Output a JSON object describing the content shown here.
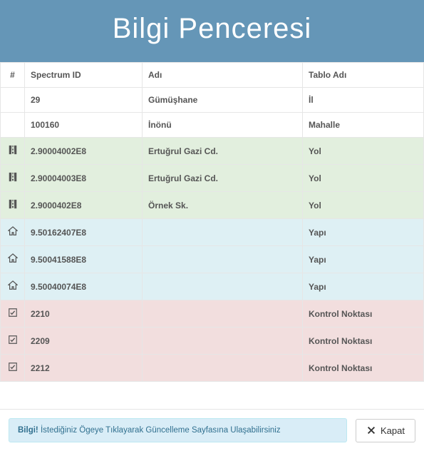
{
  "header": {
    "title": "Bilgi Penceresi"
  },
  "table": {
    "columns": [
      "#",
      "Spectrum ID",
      "Adı",
      "Tablo Adı"
    ],
    "rows": [
      {
        "icon": "",
        "row_class": "plain",
        "spectrum_id": "29",
        "name": "Gümüşhane",
        "table_name": "İl"
      },
      {
        "icon": "",
        "row_class": "plain",
        "spectrum_id": "100160",
        "name": "İnönü",
        "table_name": "Mahalle"
      },
      {
        "icon": "road",
        "row_class": "green",
        "spectrum_id": "2.90004002E8",
        "name": "Ertuğrul Gazi Cd.",
        "table_name": "Yol"
      },
      {
        "icon": "road",
        "row_class": "green",
        "spectrum_id": "2.90004003E8",
        "name": "Ertuğrul Gazi Cd.",
        "table_name": "Yol"
      },
      {
        "icon": "road",
        "row_class": "green",
        "spectrum_id": "2.9000402E8",
        "name": "Örnek Sk.",
        "table_name": "Yol"
      },
      {
        "icon": "home",
        "row_class": "blue",
        "spectrum_id": "9.50162407E8",
        "name": "",
        "table_name": "Yapı"
      },
      {
        "icon": "home",
        "row_class": "blue",
        "spectrum_id": "9.50041588E8",
        "name": "",
        "table_name": "Yapı"
      },
      {
        "icon": "home",
        "row_class": "blue",
        "spectrum_id": "9.50040074E8",
        "name": "",
        "table_name": "Yapı"
      },
      {
        "icon": "check",
        "row_class": "pink",
        "spectrum_id": "2210",
        "name": "",
        "table_name": "Kontrol Noktası"
      },
      {
        "icon": "check",
        "row_class": "pink",
        "spectrum_id": "2209",
        "name": "",
        "table_name": "Kontrol Noktası"
      },
      {
        "icon": "check",
        "row_class": "pink",
        "spectrum_id": "2212",
        "name": "",
        "table_name": "Kontrol Noktası"
      }
    ]
  },
  "footer": {
    "info_strong": "Bilgi!",
    "info_text": " İstediğiniz Ögeye Tıklayarak Güncelleme Sayfasına Ulaşabilirsiniz",
    "close_label": "Kapat"
  }
}
